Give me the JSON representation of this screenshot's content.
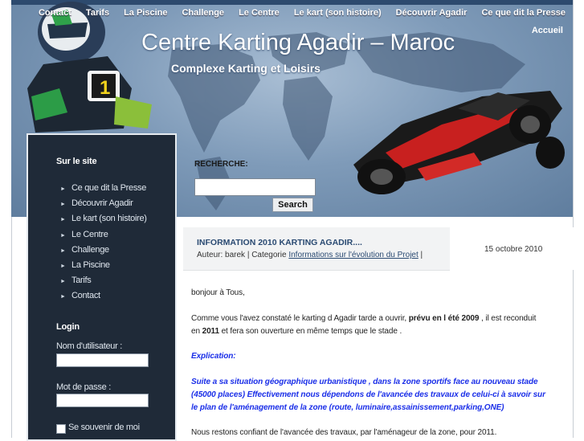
{
  "nav": [
    "Contact",
    "Tarifs",
    "La Piscine",
    "Challenge",
    "Le Centre",
    "Le kart (son histoire)",
    "Découvrir Agadir",
    "Ce que dit la Presse"
  ],
  "accueil": "Accueil",
  "header": {
    "title": "Centre Karting Agadir – Maroc",
    "subtitle": "Complexe Karting et Loisirs",
    "kart_number": "1"
  },
  "search": {
    "label": "RECHERCHE:",
    "button": "Search",
    "value": ""
  },
  "sidebar": {
    "site_heading": "Sur le site",
    "items": [
      "Ce que dit la Presse",
      "Découvrir Agadir",
      "Le kart (son histoire)",
      "Le Centre",
      "Challenge",
      "La Piscine",
      "Tarifs",
      "Contact"
    ],
    "login_heading": "Login",
    "username_label": "Nom d'utilisateur :",
    "password_label": "Mot de passe :",
    "remember_label": "Se souvenir de moi"
  },
  "post": {
    "title": "INFORMATION 2010 KARTING AGADIR....",
    "meta_prefix": "Auteur: barek | Categorie ",
    "category": "Informations sur l'évolution du Projet",
    "meta_suffix": " |",
    "date": "15 octobre 2010",
    "greeting": "bonjour à Tous,",
    "p1_a": "Comme vous l'avez constaté le karting d Agadir tarde a ouvrir, ",
    "p1_b": "prévu en l été   2009",
    "p1_c": " , il est reconduit",
    "p1_d": "en ",
    "p1_e": "2011",
    "p1_f": " et fera son ouverture en même temps que le stade .",
    "explication": "Explication:",
    "p2_line1": "Suite a sa situation géographique urbanistique ,  dans la  zone sportifs face au nouveau stade",
    "p2_line2": "(45000 places) Effectivement nous dépendons de l'avancée des travaux de celui-ci à savoir sur",
    "p2_line3": "le plan de l'aménagement de  la zone (route, luminaire,assainissement,parking,ONE)",
    "p3": "Nous restons confiant de l'avancée des travaux,  par l'aménageur de la zone,  pour 2011."
  },
  "colors": {
    "sidebar_bg": "#1f2a38",
    "link": "#2a4a72",
    "emphasis_blue": "#1a2ee8"
  }
}
